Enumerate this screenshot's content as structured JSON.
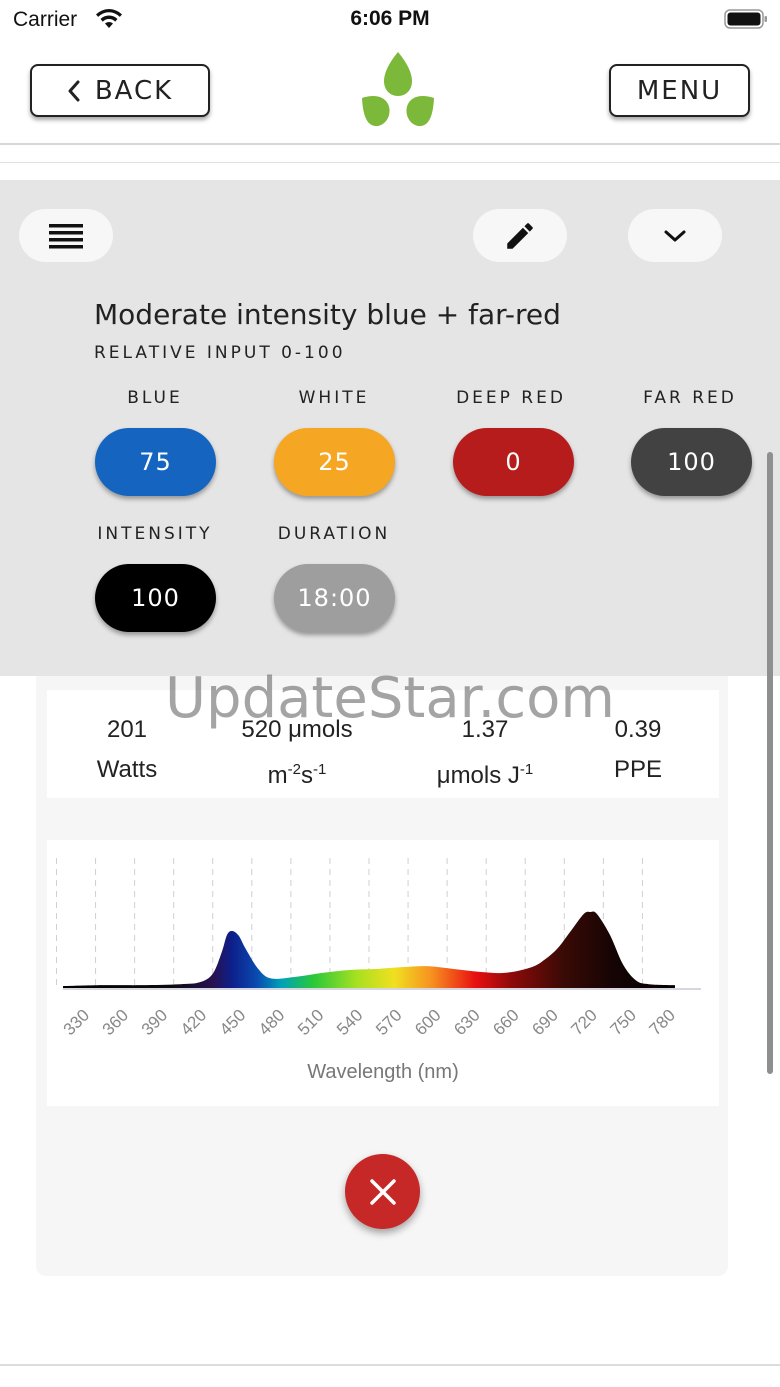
{
  "status_bar": {
    "carrier": "Carrier",
    "time": "6:06 PM"
  },
  "nav": {
    "back_label": "BACK",
    "menu_label": "MENU",
    "logo_icon": "leaf-logo-icon"
  },
  "recipe": {
    "title": "Moderate intensity blue + far-red",
    "subtitle": "RELATIVE INPUT 0-100",
    "channels": [
      {
        "label": "BLUE",
        "value": "75",
        "color": "#1565c0"
      },
      {
        "label": "WHITE",
        "value": "25",
        "color": "#f5a623"
      },
      {
        "label": "DEEP RED",
        "value": "0",
        "color": "#b71c1c"
      },
      {
        "label": "FAR RED",
        "value": "100",
        "color": "#424242"
      },
      {
        "label": "INTENSITY",
        "value": "100",
        "color": "#000000"
      },
      {
        "label": "DURATION",
        "value": "18:00",
        "color": "#9e9e9e"
      }
    ]
  },
  "metrics": {
    "watts_value": "201",
    "watts_unit": "Watts",
    "ppfd_value": "520 μmols",
    "ppfd_unit_base": "m",
    "ppfd_sup1": "-2",
    "ppfd_unit_s": "s",
    "ppfd_sup2": "-1",
    "efficacy_value": "1.37",
    "efficacy_unit": "μmols J",
    "efficacy_sup": "-1",
    "ppe_value": "0.39",
    "ppe_unit": "PPE"
  },
  "watermark": "UpdateStar.com",
  "chart_data": {
    "type": "area",
    "xlabel": "Wavelength (nm)",
    "ylabel": "",
    "x_ticks": [
      330,
      360,
      390,
      420,
      450,
      480,
      510,
      540,
      570,
      600,
      630,
      660,
      690,
      720,
      750,
      780
    ],
    "xlim": [
      320,
      800
    ],
    "ylim": [
      0,
      1
    ],
    "grid": true,
    "x": [
      320,
      350,
      380,
      410,
      425,
      435,
      442,
      446,
      450,
      455,
      460,
      470,
      480,
      500,
      520,
      540,
      560,
      580,
      600,
      620,
      640,
      660,
      680,
      690,
      700,
      710,
      720,
      725,
      730,
      740,
      750,
      760,
      770,
      790
    ],
    "y": [
      0.02,
      0.03,
      0.03,
      0.04,
      0.06,
      0.15,
      0.38,
      0.56,
      0.6,
      0.55,
      0.42,
      0.2,
      0.1,
      0.12,
      0.16,
      0.19,
      0.2,
      0.22,
      0.23,
      0.2,
      0.17,
      0.16,
      0.22,
      0.3,
      0.42,
      0.6,
      0.78,
      0.8,
      0.78,
      0.56,
      0.25,
      0.08,
      0.04,
      0.03
    ]
  }
}
